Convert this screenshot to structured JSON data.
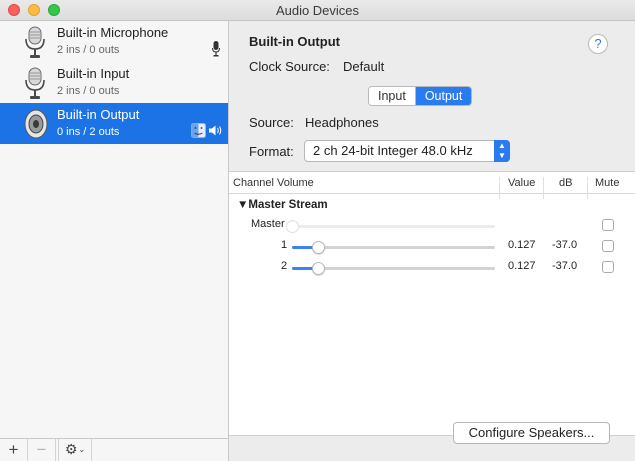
{
  "window": {
    "title": "Audio Devices"
  },
  "devices": [
    {
      "name": "Built-in Microphone",
      "io": "2 ins / 0 outs",
      "selected": false,
      "icon": "microphone-icon",
      "status_icon": "mic-input-icon"
    },
    {
      "name": "Built-in Input",
      "io": "2 ins / 0 outs",
      "selected": false,
      "icon": "microphone-icon",
      "status_icon": ""
    },
    {
      "name": "Built-in Output",
      "io": "0 ins / 2 outs",
      "selected": true,
      "icon": "speaker-icon",
      "status_icon": "finder-speaker-icon"
    }
  ],
  "sidebar_buttons": {
    "add": "+",
    "remove": "−",
    "action": "⚙"
  },
  "detail": {
    "title": "Built-in Output",
    "clock_source_label": "Clock Source:",
    "clock_source_value": "Default",
    "help": "?",
    "tabs": [
      {
        "label": "Input",
        "active": false
      },
      {
        "label": "Output",
        "active": true
      }
    ],
    "source_label": "Source:",
    "source_value": "Headphones",
    "format_label": "Format:",
    "format_value": "2 ch 24-bit Integer 48.0 kHz"
  },
  "table": {
    "headers": {
      "channel": "Channel Volume",
      "value": "Value",
      "db": "dB",
      "mute": "Mute"
    },
    "group": "Master Stream",
    "rows": [
      {
        "label": "Master",
        "value": "",
        "db": "",
        "level": 0.0,
        "enabled": false,
        "muted": false
      },
      {
        "label": "1",
        "value": "0.127",
        "db": "-37.0",
        "level": 0.127,
        "enabled": true,
        "muted": false
      },
      {
        "label": "2",
        "value": "0.127",
        "db": "-37.0",
        "level": 0.127,
        "enabled": true,
        "muted": false
      }
    ]
  },
  "configure_button": "Configure Speakers...",
  "colors": {
    "accent": "#1c73e5",
    "tab_active": "#2b7bf0",
    "slider_fill": "#3b82f0"
  }
}
